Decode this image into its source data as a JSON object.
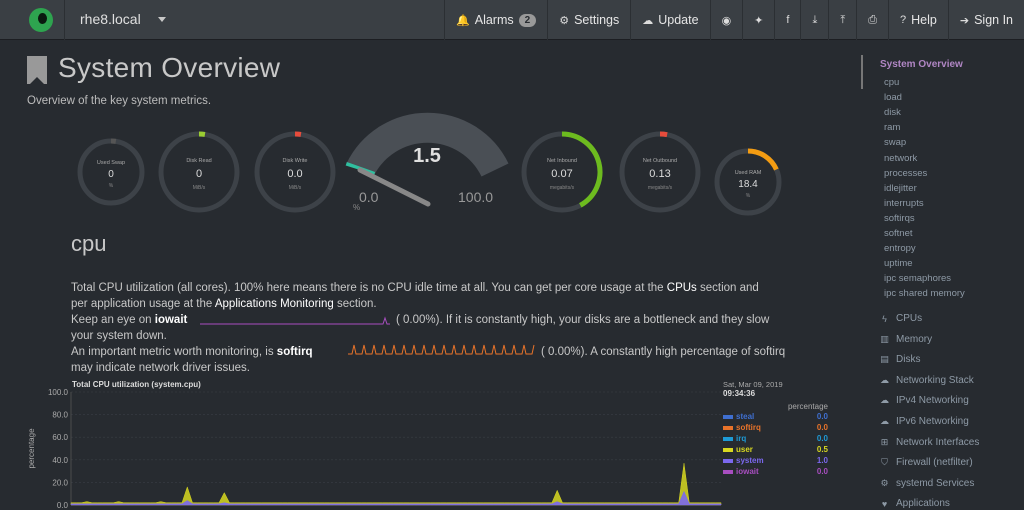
{
  "navbar": {
    "hostname": "rhe8.local",
    "items": [
      {
        "icon": "bell-icon",
        "glyph": "🔔",
        "label": "Alarms",
        "badge": "2"
      },
      {
        "icon": "gear-icon",
        "glyph": "⚙",
        "label": "Settings"
      },
      {
        "icon": "cloud-download-icon",
        "glyph": "☁",
        "label": "Update"
      },
      {
        "icon": "github-icon",
        "glyph": "◉",
        "label": ""
      },
      {
        "icon": "twitter-icon",
        "glyph": "✦",
        "label": ""
      },
      {
        "icon": "facebook-icon",
        "glyph": "f",
        "label": ""
      },
      {
        "icon": "download-icon",
        "glyph": "⤓",
        "label": ""
      },
      {
        "icon": "upload-icon",
        "glyph": "⤒",
        "label": ""
      },
      {
        "icon": "print-icon",
        "glyph": "⎙",
        "label": ""
      },
      {
        "icon": "help-icon",
        "glyph": "?",
        "label": "Help"
      },
      {
        "icon": "sign-in-icon",
        "glyph": "➔",
        "label": "Sign In"
      }
    ]
  },
  "page": {
    "title": "System Overview",
    "subtitle": "Overview of the key system metrics."
  },
  "gauges": [
    {
      "id": "used-swap",
      "title": "Used Swap",
      "value": "0",
      "unit": "%",
      "fraction": 0,
      "color": "#555555"
    },
    {
      "id": "disk-read",
      "title": "Disk Read",
      "value": "0",
      "unit": "MiB/s",
      "fraction": 0,
      "color": "#9acd32"
    },
    {
      "id": "disk-write",
      "title": "Disk Write",
      "value": "0.0",
      "unit": "MiB/s",
      "fraction": 0,
      "color": "#e74c3c"
    },
    {
      "id": "net-inbound",
      "title": "Net Inbound",
      "value": "0.07",
      "unit": "megabits/s",
      "fraction": 0.42,
      "color": "#6dbb1f"
    },
    {
      "id": "net-outbound",
      "title": "Net Outbound",
      "value": "0.13",
      "unit": "megabits/s",
      "fraction": 0.03,
      "color": "#e74c3c"
    },
    {
      "id": "used-ram",
      "title": "Used RAM",
      "value": "18.4",
      "unit": "%",
      "fraction": 0.184,
      "color": "#f39c12"
    }
  ],
  "cpu_gauge": {
    "title": "CPU",
    "value": "1.5",
    "min": "0.0",
    "max": "100.0",
    "unit": "%",
    "fraction": 0.015
  },
  "section": {
    "heading": "cpu",
    "desc1a": "Total CPU utilization (all cores). 100% here means there is no CPU idle time at all. You can get per core usage at the ",
    "desc1_link": "CPUs",
    "desc1b": " section and",
    "desc2a": "per application usage at the ",
    "desc2_link": "Applications Monitoring",
    "desc2b": " section.",
    "desc3a": "Keep an eye on ",
    "desc3_bold": "iowait",
    "desc3_val": "(      0.00%). If it is constantly high, your disks are a bottleneck and they slow",
    "desc4": "your system down.",
    "desc5a": "An important metric worth monitoring, is ",
    "desc5_bold": "softirq",
    "desc5_val": "(      0.00%). A constantly high percentage of softirq",
    "desc6": "may indicate network driver issues."
  },
  "chart_data": {
    "type": "area",
    "title": "Total CPU utilization (system.cpu)",
    "ylabel": "percentage",
    "ylim": [
      0,
      100
    ],
    "yticks": [
      "100.0",
      "80.0",
      "60.0",
      "40.0",
      "20.0",
      "0.0"
    ],
    "date": "Sat, Mar 09, 2019",
    "time": "09:34:36",
    "unit_label": "percentage",
    "series": [
      {
        "name": "steal",
        "value": "0.0",
        "color": "#3f6fd0"
      },
      {
        "name": "softirq",
        "value": "0.0",
        "color": "#e8732a"
      },
      {
        "name": "irq",
        "value": "0.0",
        "color": "#1e9bd7"
      },
      {
        "name": "user",
        "value": "0.5",
        "color": "#d8d820"
      },
      {
        "name": "system",
        "value": "1.0",
        "color": "#7b68ee"
      },
      {
        "name": "iowait",
        "value": "0.0",
        "color": "#a84ec0"
      }
    ],
    "user_trace": [
      1,
      1,
      1,
      2,
      1,
      1,
      1,
      1,
      1,
      2,
      1,
      1,
      1,
      1,
      1,
      1,
      1,
      2,
      1,
      1,
      1,
      1,
      12,
      1,
      1,
      1,
      1,
      1,
      1,
      9,
      1,
      1,
      1,
      1,
      1,
      1,
      1,
      1,
      1,
      1,
      1,
      1,
      1,
      1,
      1,
      1,
      1,
      1,
      1,
      1,
      1,
      1,
      1,
      1,
      1,
      1,
      1,
      1,
      1,
      1,
      1,
      1,
      1,
      1,
      1,
      1,
      1,
      1,
      1,
      1,
      1,
      1,
      1,
      1,
      1,
      1,
      1,
      1,
      1,
      1,
      1,
      1,
      1,
      1,
      1,
      1,
      1,
      1,
      1,
      1,
      1,
      1,
      10,
      1,
      1,
      1,
      1,
      1,
      1,
      1,
      1,
      1,
      1,
      1,
      1,
      1,
      1,
      1,
      1,
      1,
      1,
      1,
      1,
      1,
      1,
      1,
      25,
      1,
      1,
      1,
      1,
      1,
      1,
      1
    ],
    "system_trace": [
      1,
      1,
      1,
      1,
      1,
      1,
      1,
      1,
      1,
      1,
      1,
      1,
      1,
      1,
      1,
      1,
      1,
      1,
      1,
      1,
      1,
      1,
      4,
      1,
      1,
      1,
      1,
      1,
      1,
      2,
      1,
      1,
      1,
      1,
      1,
      1,
      1,
      1,
      1,
      1,
      1,
      1,
      1,
      1,
      1,
      1,
      1,
      1,
      1,
      1,
      1,
      1,
      1,
      1,
      1,
      1,
      1,
      1,
      1,
      1,
      1,
      1,
      1,
      1,
      1,
      1,
      1,
      1,
      1,
      1,
      1,
      1,
      1,
      1,
      1,
      1,
      1,
      1,
      1,
      1,
      1,
      1,
      1,
      1,
      1,
      1,
      1,
      1,
      1,
      1,
      1,
      1,
      3,
      1,
      1,
      1,
      1,
      1,
      1,
      1,
      1,
      1,
      1,
      1,
      1,
      1,
      1,
      1,
      1,
      1,
      1,
      1,
      1,
      1,
      1,
      1,
      12,
      1,
      1,
      1,
      1,
      1,
      1,
      1
    ]
  },
  "sidebar": {
    "active": "System Overview",
    "subs": [
      "cpu",
      "load",
      "disk",
      "ram",
      "swap",
      "network",
      "processes",
      "idlejitter",
      "interrupts",
      "softirqs",
      "softnet",
      "entropy",
      "uptime",
      "ipc semaphores",
      "ipc shared memory"
    ],
    "sections": [
      {
        "label": "CPUs",
        "icon": "bolt-icon",
        "glyph": "ϟ"
      },
      {
        "label": "Memory",
        "icon": "memory-icon",
        "glyph": "▥"
      },
      {
        "label": "Disks",
        "icon": "hdd-icon",
        "glyph": "▤"
      },
      {
        "label": "Networking Stack",
        "icon": "cloud-icon",
        "glyph": "☁"
      },
      {
        "label": "IPv4 Networking",
        "icon": "cloud-icon",
        "glyph": "☁"
      },
      {
        "label": "IPv6 Networking",
        "icon": "cloud-icon",
        "glyph": "☁"
      },
      {
        "label": "Network Interfaces",
        "icon": "sitemap-icon",
        "glyph": "⊞"
      },
      {
        "label": "Firewall (netfilter)",
        "icon": "shield-icon",
        "glyph": "⛉"
      },
      {
        "label": "systemd Services",
        "icon": "cogs-icon",
        "glyph": "⚙"
      },
      {
        "label": "Applications",
        "icon": "heartbeat-icon",
        "glyph": "♥"
      }
    ]
  }
}
